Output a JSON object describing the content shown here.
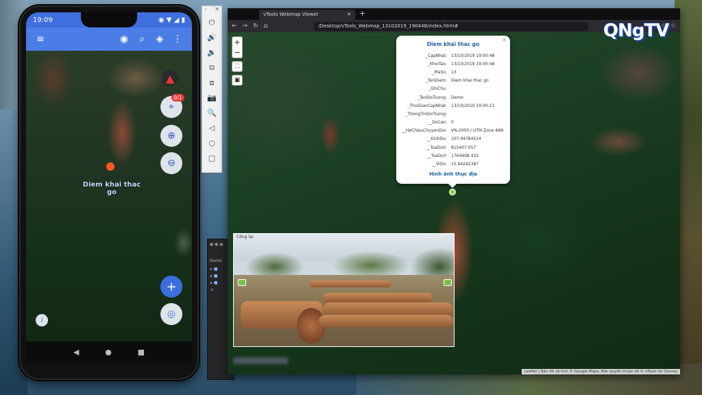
{
  "phone": {
    "status_time": "19:09",
    "status_icons": "◉ ▼ ◢ ▮",
    "gps_badge": "0/1",
    "marker_label": "Diem khai thac go",
    "nav": {
      "back": "◀",
      "home": "●",
      "recent": "■"
    }
  },
  "emulator": {
    "buttons": [
      "⏻",
      "🔊",
      "🔉",
      "⧉",
      "⧈",
      "📷",
      "🔍",
      "◁",
      "○",
      "□",
      "⋯"
    ]
  },
  "browser": {
    "tab_title": "vTools Webmap Viewer",
    "url": "/Desktop/vTools_Webmap_13102019_190448/index.html#"
  },
  "map": {
    "popup": {
      "title": "Diem khai thac go",
      "rows": [
        {
          "label": "_CapNhat:",
          "value": "13/10/2019 19:00:48"
        },
        {
          "label": "_KhoiTao:",
          "value": "13/10/2019 19:00:48"
        },
        {
          "label": "_MaSo:",
          "value": "13"
        },
        {
          "label": "_TenDiem:",
          "value": "Diem khai thac go"
        },
        {
          "label": "_GhiChu:",
          "value": ""
        },
        {
          "label": "_TenDoiTuong:",
          "value": "Demo"
        },
        {
          "label": "_ThoiGianCapNhat:",
          "value": "13/10/2019 19:00:23"
        },
        {
          "label": "_ThongTinDoiTuong:",
          "value": ""
        },
        {
          "label": "__DoCao:",
          "value": "0"
        },
        {
          "label": "__HeChieuChuyenDoi:",
          "value": "VN-2000 / UTM Zone 48N"
        },
        {
          "label": "__KinhDo:",
          "value": "107.94784514"
        },
        {
          "label": "__ToaDoX:",
          "value": "815407.057"
        },
        {
          "label": "__ToaDoY:",
          "value": "1764908.433"
        },
        {
          "label": "__ViDo:",
          "value": "15.94242387"
        }
      ],
      "link": "Hình ảnh thực địa"
    },
    "photo_title": "Công lại",
    "attribution": "Leaflet | Bản đồ vệ tinh © Google Maps, Bản quyền thuộc về © vTools for Survey"
  },
  "finder": {
    "label": "Name"
  },
  "watermark": "QNgTV"
}
